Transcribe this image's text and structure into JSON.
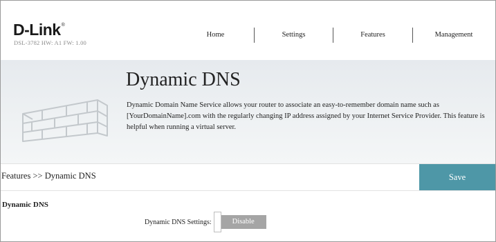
{
  "header": {
    "logo": "D-Link",
    "logo_mark": "®",
    "device_info": "DSL-3782  HW: A1  FW: 1.00",
    "nav": [
      {
        "label": "Home"
      },
      {
        "label": "Settings"
      },
      {
        "label": "Features"
      },
      {
        "label": "Management"
      }
    ]
  },
  "banner": {
    "icon": "brick-wall-icon",
    "title": "Dynamic DNS",
    "description": "Dynamic Domain Name Service allows your router to associate an easy-to-remember domain name such as [YourDomainName].com with the regularly changing IP address assigned by your Internet Service Provider. This feature is helpful when running a virtual server."
  },
  "breadcrumb": "Features >> Dynamic DNS",
  "save_label": "Save",
  "section": {
    "title": "Dynamic DNS",
    "setting_label": "Dynamic DNS Settings:",
    "toggle_state": "Disable"
  },
  "colors": {
    "save_button": "#4e97a7",
    "toggle_off": "#a5a5a5",
    "banner_bg": "#e6eaee"
  }
}
